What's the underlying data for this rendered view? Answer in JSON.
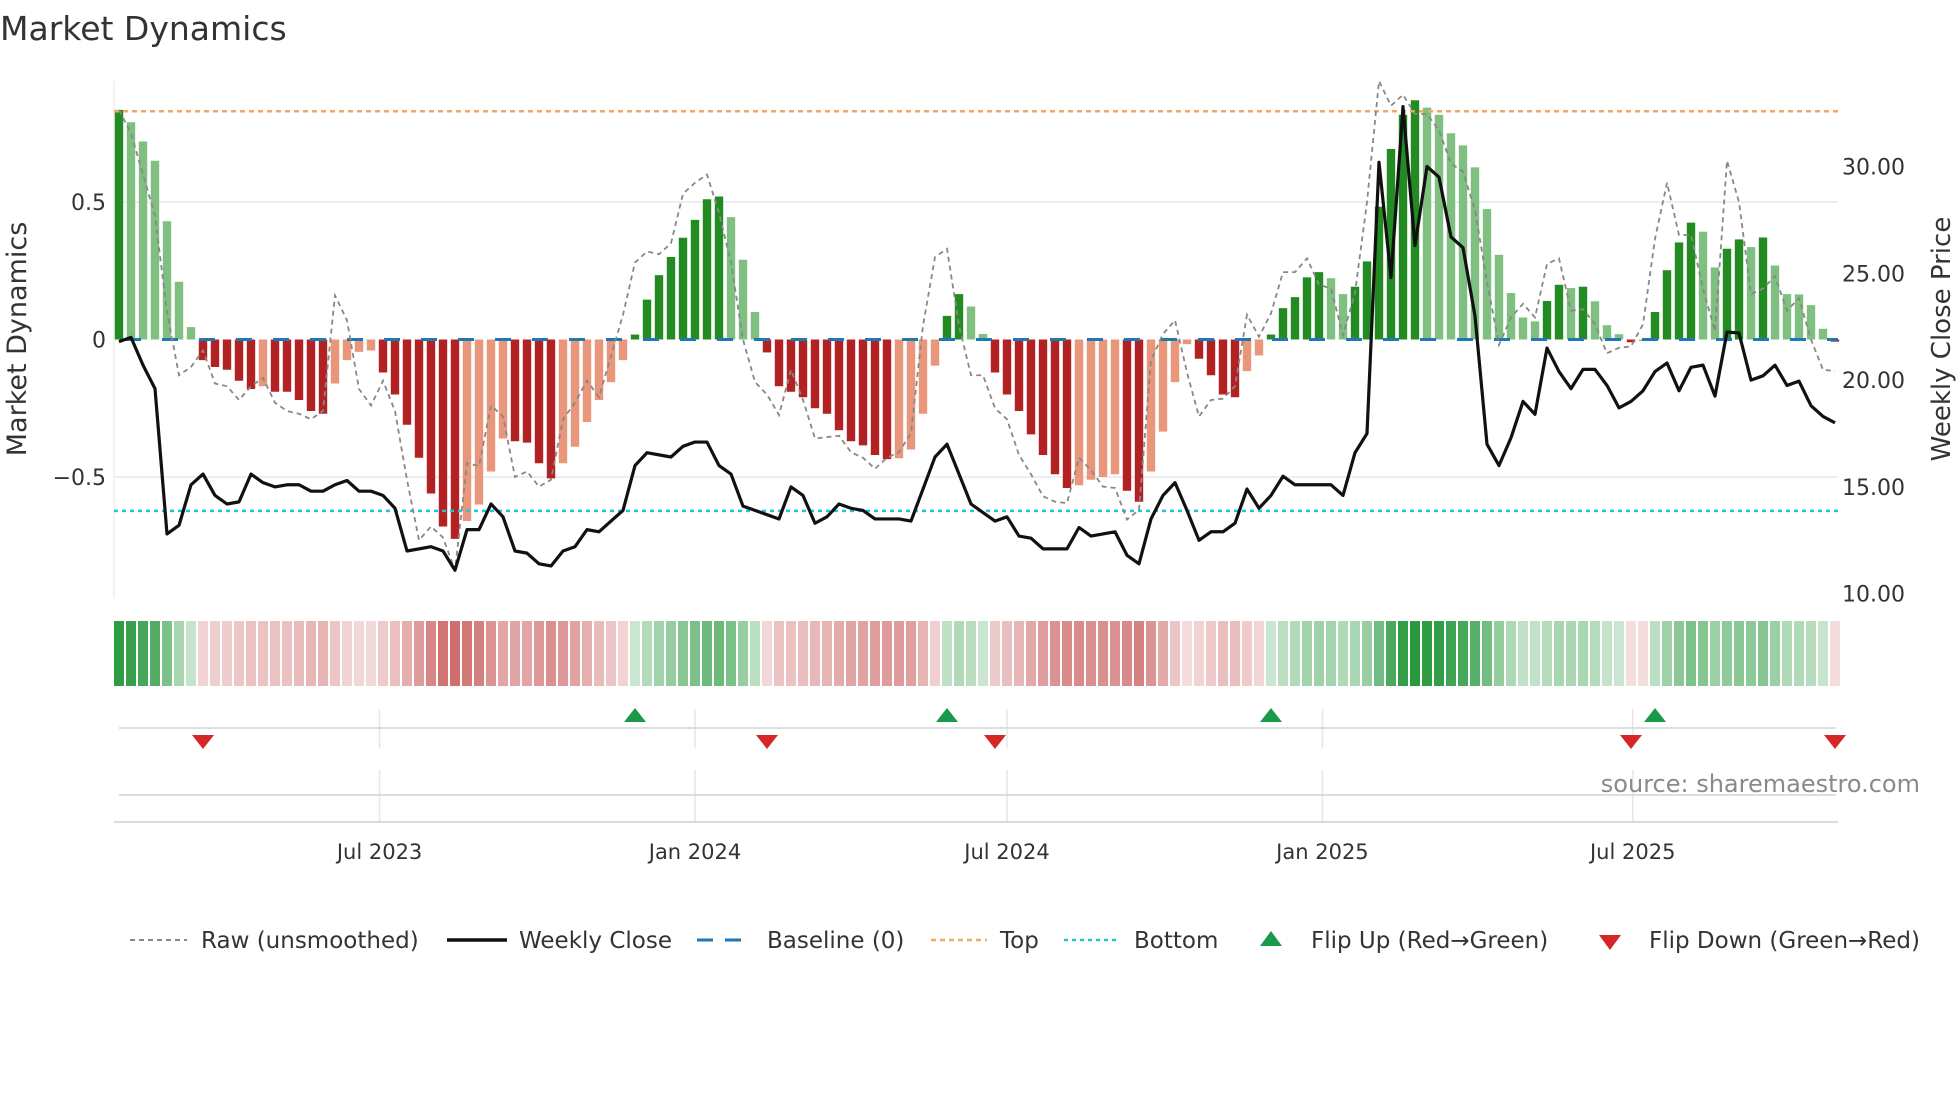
{
  "chart_data": {
    "type": "bar",
    "title": "Market Dynamics",
    "ylabel_left": "Market Dynamics",
    "ylabel_right": "Weekly Close Price",
    "source": "source: sharemaestro.com",
    "start_date": "2023-01-30",
    "frequency": "weekly",
    "ylim_left": [
      -0.94,
      0.94
    ],
    "ylim_right": [
      9.8,
      34
    ],
    "left_ticks": [
      {
        "v": 0.5,
        "label": "0.5"
      },
      {
        "v": 0,
        "label": "0"
      },
      {
        "v": -0.5,
        "label": "−0.5"
      }
    ],
    "right_ticks": [
      {
        "v": 30,
        "label": "30.00"
      },
      {
        "v": 25,
        "label": "25.00"
      },
      {
        "v": 20,
        "label": "20.00"
      },
      {
        "v": 15,
        "label": "15.00"
      },
      {
        "v": 10,
        "label": "10.00"
      }
    ],
    "x_ticks": [
      {
        "date": "2023-07-01",
        "label": "Jul 2023"
      },
      {
        "date": "2024-01-01",
        "label": "Jan 2024"
      },
      {
        "date": "2024-07-01",
        "label": "Jul 2024"
      },
      {
        "date": "2025-01-01",
        "label": "Jan 2025"
      },
      {
        "date": "2025-07-01",
        "label": "Jul 2025"
      }
    ],
    "grid": true,
    "top_level": 0.83,
    "bottom_level": -0.623,
    "baseline": 0,
    "colors": {
      "up_strong": "#228b22",
      "up_weak": "#7fbf7f",
      "down_strong": "#b22222",
      "down_weak": "#e9967a",
      "raw": "#888888",
      "close": "#111111",
      "baseline": "#1f77b4",
      "top": "#f0a868",
      "bottom": "#22c5d8",
      "flip_up": "#1a9a48",
      "flip_down": "#d62728"
    },
    "legend": {
      "placement": "bottom",
      "entries": [
        "Raw (unsmoothed)",
        "Weekly Close",
        "Baseline (0)",
        "Top",
        "Bottom",
        "Flip Up (Red→Green)",
        "Flip Down (Green→Red)"
      ]
    },
    "series": [
      {
        "name": "Smoothed",
        "kind": "bar",
        "values": [
          0.835,
          0.79,
          0.72,
          0.65,
          0.43,
          0.21,
          0.045,
          -0.075,
          -0.1,
          -0.11,
          -0.15,
          -0.18,
          -0.17,
          -0.19,
          -0.19,
          -0.22,
          -0.26,
          -0.27,
          -0.16,
          -0.075,
          -0.045,
          -0.04,
          -0.12,
          -0.2,
          -0.31,
          -0.43,
          -0.56,
          -0.68,
          -0.725,
          -0.66,
          -0.6,
          -0.48,
          -0.36,
          -0.37,
          -0.375,
          -0.45,
          -0.505,
          -0.45,
          -0.39,
          -0.3,
          -0.22,
          -0.155,
          -0.075,
          0.018,
          0.145,
          0.234,
          0.3,
          0.37,
          0.435,
          0.51,
          0.52,
          0.445,
          0.29,
          0.1,
          -0.047,
          -0.17,
          -0.19,
          -0.21,
          -0.25,
          -0.27,
          -0.33,
          -0.37,
          -0.385,
          -0.42,
          -0.435,
          -0.432,
          -0.4,
          -0.27,
          -0.095,
          0.086,
          0.165,
          0.12,
          0.02,
          -0.12,
          -0.2,
          -0.26,
          -0.345,
          -0.42,
          -0.49,
          -0.54,
          -0.53,
          -0.51,
          -0.5,
          -0.49,
          -0.55,
          -0.59,
          -0.48,
          -0.335,
          -0.155,
          -0.017,
          -0.07,
          -0.13,
          -0.2,
          -0.21,
          -0.115,
          -0.058,
          0.018,
          0.114,
          0.154,
          0.226,
          0.245,
          0.223,
          0.165,
          0.192,
          0.284,
          0.483,
          0.693,
          0.817,
          0.87,
          0.843,
          0.817,
          0.75,
          0.706,
          0.626,
          0.474,
          0.308,
          0.169,
          0.08,
          0.066,
          0.14,
          0.199,
          0.187,
          0.192,
          0.139,
          0.052,
          0.019,
          -0.01,
          -0.005,
          0.1,
          0.252,
          0.353,
          0.425,
          0.392,
          0.262,
          0.33,
          0.364,
          0.336,
          0.371,
          0.269,
          0.165,
          0.164,
          0.125,
          0.039,
          -0.008
        ]
      },
      {
        "name": "Raw (unsmoothed)",
        "kind": "line",
        "values": [
          0.835,
          0.75,
          0.6,
          0.45,
          0.1,
          -0.13,
          -0.1,
          -0.04,
          -0.16,
          -0.17,
          -0.22,
          -0.17,
          -0.14,
          -0.23,
          -0.26,
          -0.27,
          -0.29,
          -0.26,
          0.16,
          0.07,
          -0.18,
          -0.24,
          -0.15,
          -0.26,
          -0.51,
          -0.73,
          -0.68,
          -0.72,
          -0.84,
          -0.45,
          -0.46,
          -0.24,
          -0.28,
          -0.5,
          -0.48,
          -0.535,
          -0.51,
          -0.29,
          -0.23,
          -0.15,
          -0.21,
          -0.06,
          0.09,
          0.28,
          0.32,
          0.31,
          0.35,
          0.53,
          0.57,
          0.6,
          0.46,
          0.28,
          0,
          -0.155,
          -0.2,
          -0.275,
          -0.11,
          -0.22,
          -0.36,
          -0.355,
          -0.35,
          -0.41,
          -0.43,
          -0.47,
          -0.43,
          -0.41,
          -0.34,
          0.05,
          0.3,
          0.33,
          0.05,
          -0.13,
          -0.13,
          -0.25,
          -0.29,
          -0.42,
          -0.49,
          -0.57,
          -0.59,
          -0.595,
          -0.43,
          -0.475,
          -0.535,
          -0.54,
          -0.655,
          -0.62,
          -0.075,
          0.02,
          0.07,
          -0.12,
          -0.28,
          -0.22,
          -0.215,
          -0.17,
          0.09,
          0.01,
          0.095,
          0.245,
          0.245,
          0.295,
          0.2,
          0.185,
          0.015,
          0.17,
          0.5,
          0.94,
          0.85,
          0.89,
          0.82,
          0.82,
          0.76,
          0.64,
          0.61,
          0.47,
          0.21,
          -0.02,
          0.08,
          0.13,
          0.08,
          0.275,
          0.295,
          0.105,
          0.11,
          0.055,
          -0.05,
          -0.03,
          -0.025,
          0.055,
          0.366,
          0.57,
          0.38,
          0.38,
          0.185,
          0.03,
          0.65,
          0.5,
          0.165,
          0.185,
          0.23,
          0.105,
          0.15,
          0,
          -0.11,
          -0.115
        ]
      },
      {
        "name": "Weekly Close",
        "kind": "line",
        "axis": "right",
        "values": [
          21.8,
          22.0,
          20.7,
          19.6,
          12.8,
          13.2,
          15.1,
          15.6,
          14.6,
          14.2,
          14.3,
          15.6,
          15.2,
          15.0,
          15.1,
          15.1,
          14.8,
          14.8,
          15.1,
          15.3,
          14.8,
          14.8,
          14.6,
          14.0,
          12.0,
          12.1,
          12.2,
          12.0,
          11.1,
          13.0,
          13.0,
          14.2,
          13.6,
          12.0,
          11.9,
          11.4,
          11.3,
          12.0,
          12.2,
          13.0,
          12.9,
          13.4,
          13.9,
          16.0,
          16.6,
          16.5,
          16.4,
          16.9,
          17.1,
          17.1,
          16.0,
          15.6,
          14.1,
          13.9,
          13.7,
          13.5,
          15.0,
          14.6,
          13.3,
          13.6,
          14.2,
          14.0,
          13.9,
          13.5,
          13.5,
          13.5,
          13.4,
          14.9,
          16.4,
          17.0,
          15.6,
          14.2,
          13.8,
          13.4,
          13.6,
          12.7,
          12.6,
          12.1,
          12.1,
          12.1,
          13.1,
          12.7,
          12.8,
          12.9,
          11.8,
          11.4,
          13.5,
          14.6,
          15.2,
          13.9,
          12.5,
          12.9,
          12.9,
          13.3,
          14.9,
          14.0,
          14.6,
          15.5,
          15.1,
          15.1,
          15.1,
          15.1,
          14.6,
          16.6,
          17.5,
          30.2,
          24.8,
          32.8,
          26.3,
          30.0,
          29.5,
          26.7,
          26.2,
          23.0,
          17.0,
          16.0,
          17.3,
          19.0,
          18.4,
          21.5,
          20.4,
          19.6,
          20.5,
          20.5,
          19.75,
          18.7,
          19.0,
          19.5,
          20.4,
          20.8,
          19.5,
          20.6,
          20.7,
          19.25,
          22.25,
          22.2,
          20.0,
          20.2,
          20.7,
          19.75,
          19.95,
          18.8,
          18.3,
          18.0
        ]
      }
    ],
    "flip_up_weeks": [
      43,
      69,
      96,
      128
    ],
    "flip_down_weeks": [
      7,
      54,
      73,
      126,
      143
    ]
  }
}
